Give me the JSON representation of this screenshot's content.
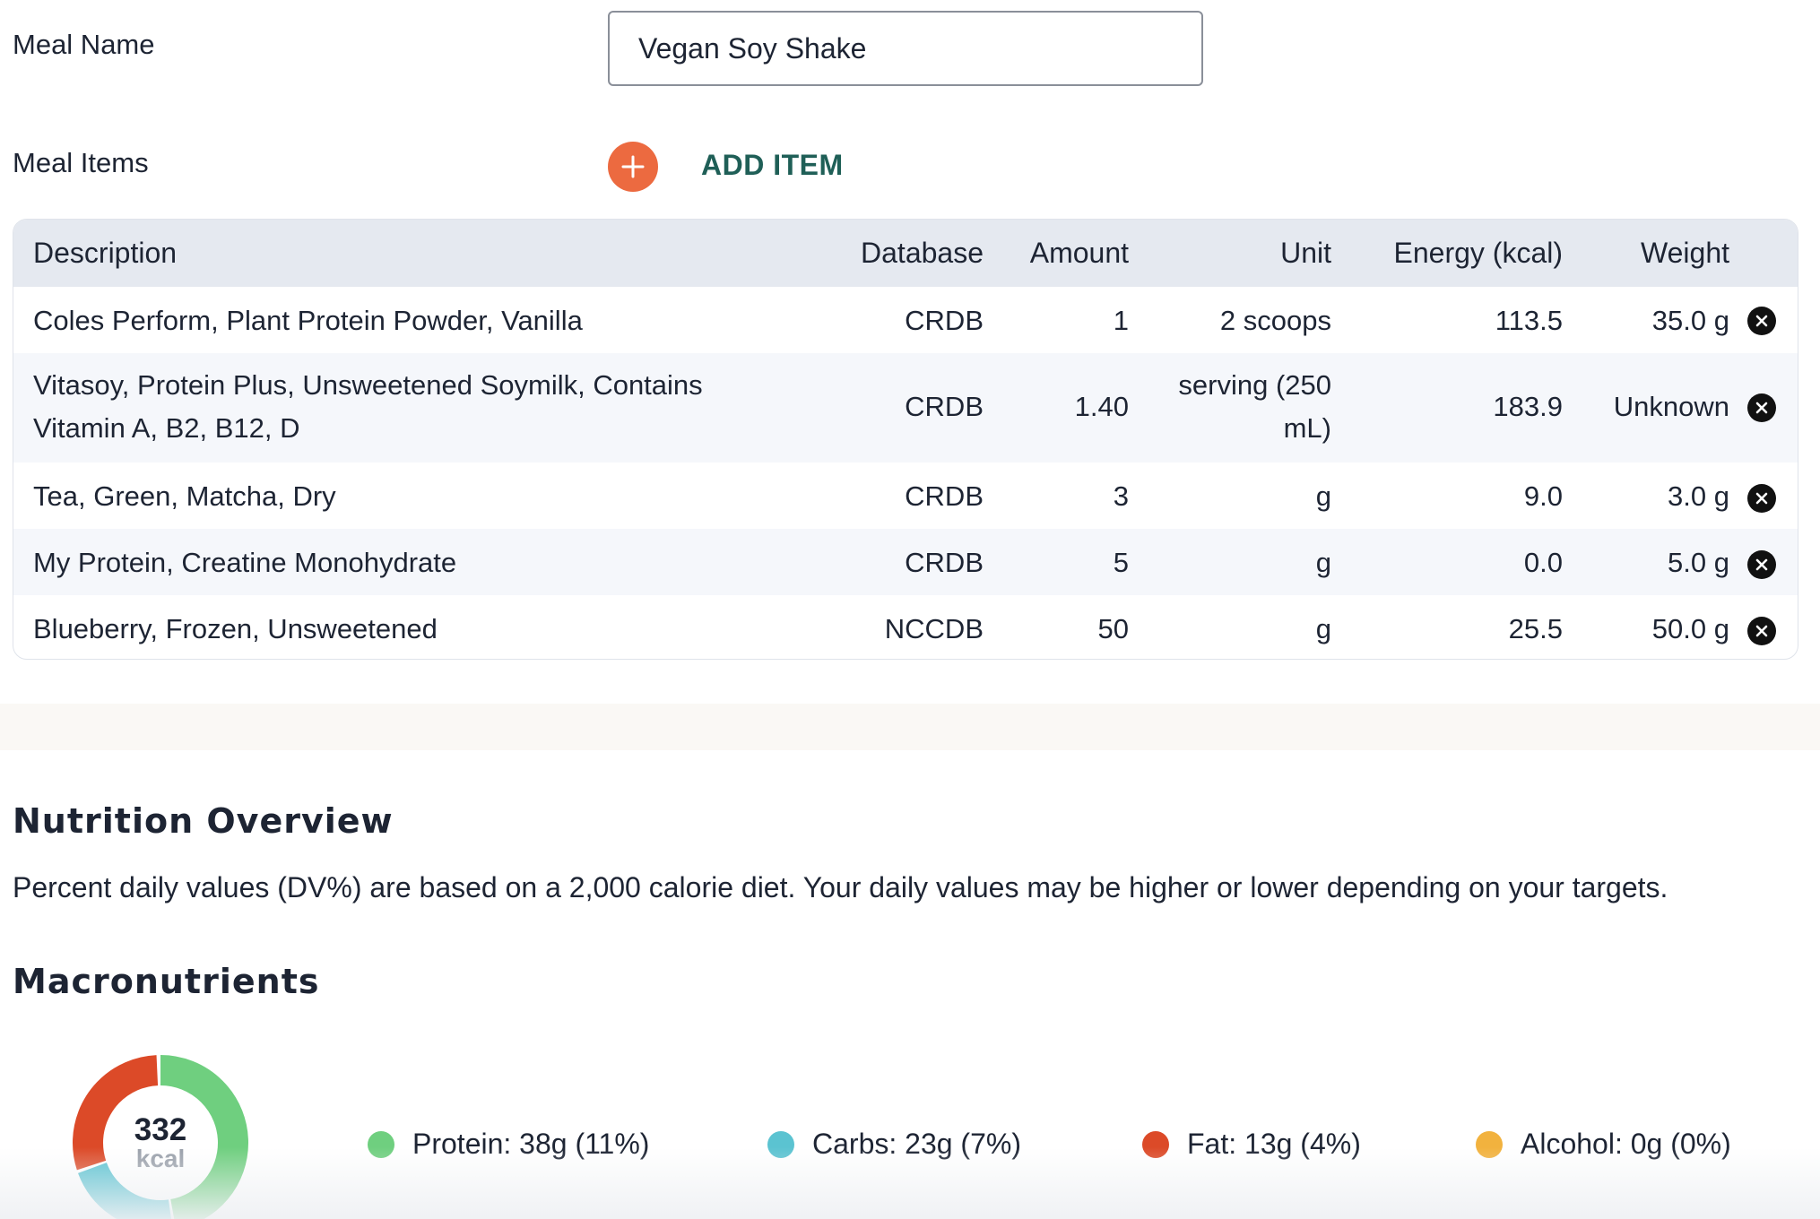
{
  "form": {
    "meal_name_label": "Meal Name",
    "meal_name_value": "Vegan Soy Shake",
    "meal_items_label": "Meal Items",
    "add_item_label": "ADD ITEM"
  },
  "table": {
    "headers": {
      "description": "Description",
      "database": "Database",
      "amount": "Amount",
      "unit": "Unit",
      "energy": "Energy (kcal)",
      "weight": "Weight"
    },
    "rows": [
      {
        "description": "Coles Perform, Plant Protein Powder, Vanilla",
        "description2": "",
        "database": "CRDB",
        "amount": "1",
        "unit": "2 scoops",
        "unit2": "",
        "energy": "113.5",
        "weight": "35.0 g"
      },
      {
        "description": "Vitasoy, Protein Plus, Unsweetened Soymilk, Contains",
        "description2": "Vitamin A, B2, B12, D",
        "database": "CRDB",
        "amount": "1.40",
        "unit": "serving (250",
        "unit2": "mL)",
        "energy": "183.9",
        "weight": "Unknown"
      },
      {
        "description": "Tea, Green, Matcha, Dry",
        "description2": "",
        "database": "CRDB",
        "amount": "3",
        "unit": "g",
        "unit2": "",
        "energy": "9.0",
        "weight": "3.0 g"
      },
      {
        "description": "My Protein, Creatine Monohydrate",
        "description2": "",
        "database": "CRDB",
        "amount": "5",
        "unit": "g",
        "unit2": "",
        "energy": "0.0",
        "weight": "5.0 g"
      },
      {
        "description": "Blueberry, Frozen, Unsweetened",
        "description2": "",
        "database": "NCCDB",
        "amount": "50",
        "unit": "g",
        "unit2": "",
        "energy": "25.5",
        "weight": "50.0 g"
      }
    ]
  },
  "nutrition": {
    "title": "Nutrition Overview",
    "description": "Percent daily values (DV%) are based on a 2,000 calorie diet. Your daily values may be higher or lower depending on your targets.",
    "macro_title": "Macronutrients",
    "kcal_value": "332",
    "kcal_unit": "kcal",
    "legend": [
      {
        "label": "Protein: 38g (11%)",
        "color": "#6fcf7f"
      },
      {
        "label": "Carbs: 23g (7%)",
        "color": "#5bc3d1"
      },
      {
        "label": "Fat: 13g (4%)",
        "color": "#dc4a28"
      },
      {
        "label": "Alcohol: 0g (0%)",
        "color": "#f2b23e"
      }
    ]
  },
  "icons": {
    "add": "plus-icon",
    "remove": "close-circle-icon"
  }
}
